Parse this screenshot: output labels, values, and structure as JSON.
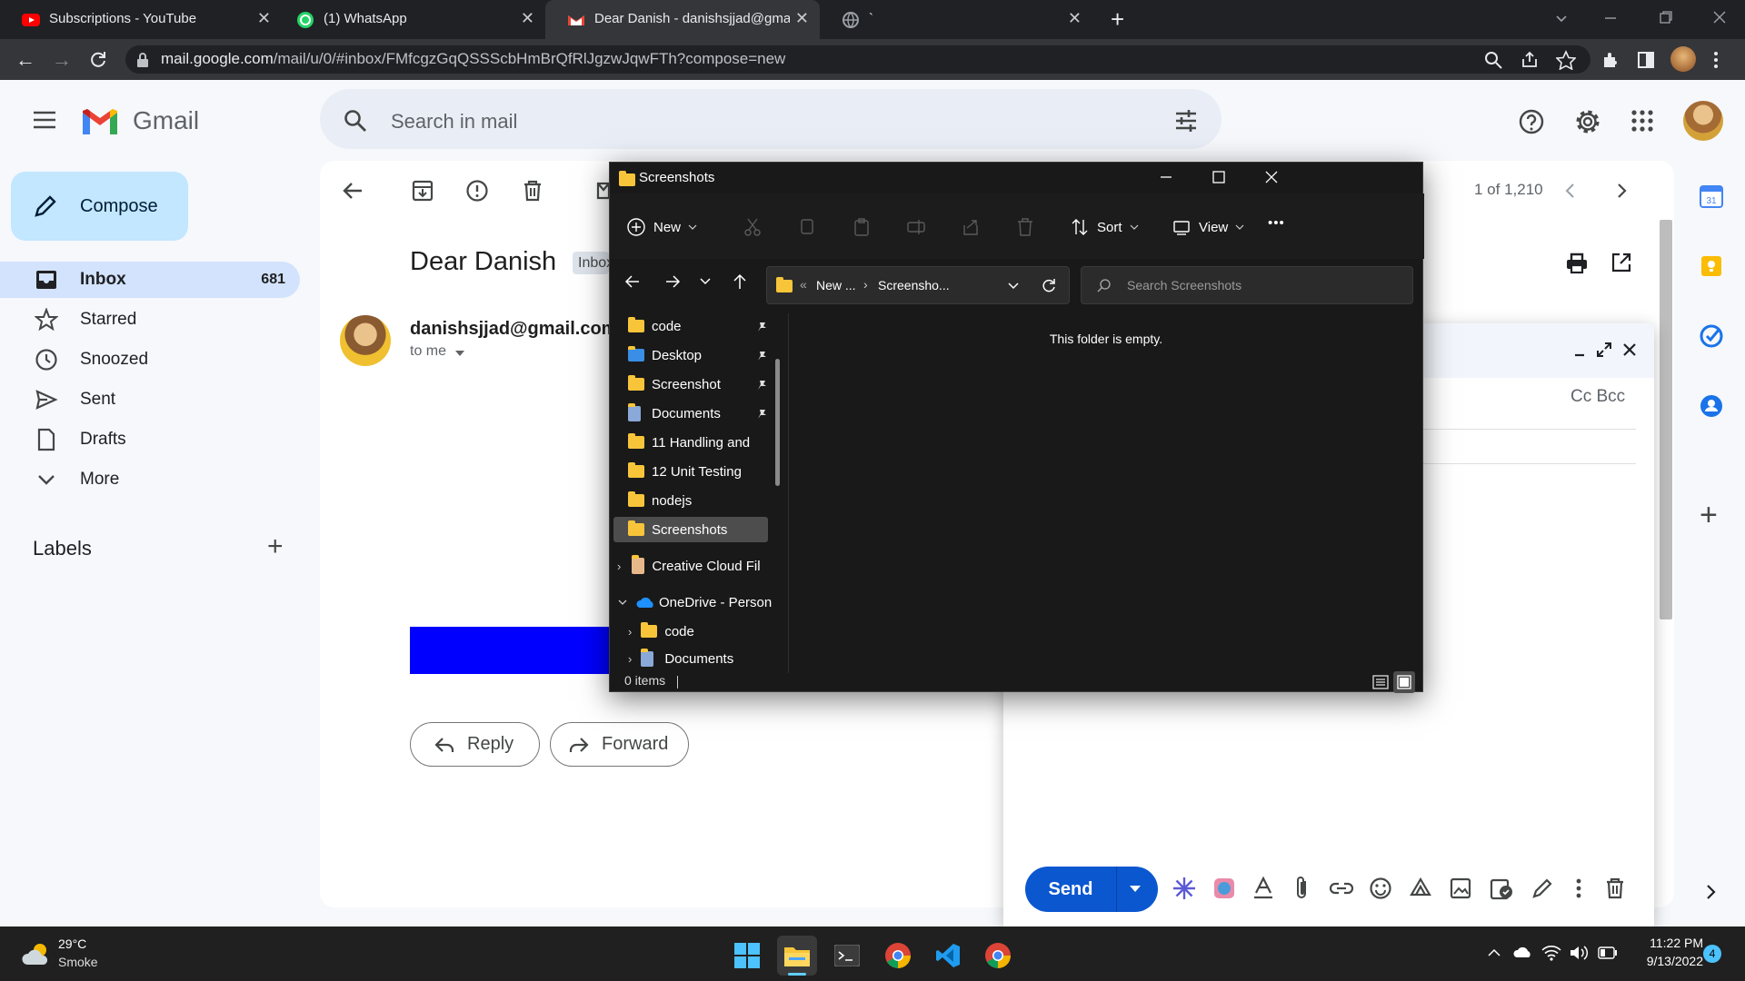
{
  "browser": {
    "tabs": [
      {
        "title": "Subscriptions - YouTube",
        "close": "✕"
      },
      {
        "title": "(1) WhatsApp",
        "close": "✕"
      },
      {
        "title": "Dear Danish - danishsjjad@gmail",
        "close": "✕"
      },
      {
        "title": "`",
        "close": "✕"
      }
    ],
    "new_tab": "+",
    "url_host": "mail.google.com",
    "url_path": "/mail/u/0/#inbox/FMfcgzGqQSSScbHmBrQfRlJgzwJqwFTh?compose=new"
  },
  "gmail": {
    "logo_text": "Gmail",
    "search_placeholder": "Search in mail",
    "compose_label": "Compose",
    "nav": [
      {
        "label": "Inbox",
        "count": "681"
      },
      {
        "label": "Starred"
      },
      {
        "label": "Snoozed"
      },
      {
        "label": "Sent"
      },
      {
        "label": "Drafts"
      },
      {
        "label": "More"
      }
    ],
    "labels_heading": "Labels",
    "labels_add": "+",
    "pager": "1 of 1,210",
    "subject": "Dear Danish",
    "inbox_chip": "Inbox",
    "sender": "danishsjjad@gmail.com",
    "to_me": "to me",
    "reply_label": "Reply",
    "forward_label": "Forward",
    "cc_bcc": "Cc Bcc",
    "send_label": "Send",
    "side_add": "+"
  },
  "explorer": {
    "title": "Screenshots",
    "new_label": "New",
    "sort_label": "Sort",
    "view_label": "View",
    "more": "•••",
    "breadcrumb": [
      "New ...",
      "Screensho..."
    ],
    "search_placeholder": "Search Screenshots",
    "empty_message": "This folder is empty.",
    "status": "0 items",
    "tree": [
      {
        "label": "code",
        "pinned": true
      },
      {
        "label": "Desktop",
        "pinned": true
      },
      {
        "label": "Screenshot",
        "pinned": true
      },
      {
        "label": "Documents",
        "pinned": true
      },
      {
        "label": "11 Handling and"
      },
      {
        "label": "12 Unit Testing"
      },
      {
        "label": "nodejs"
      },
      {
        "label": "Screenshots"
      },
      {
        "label": "Creative Cloud Fil"
      },
      {
        "label": "OneDrive - Person"
      },
      {
        "label": "code"
      },
      {
        "label": "Documents"
      }
    ]
  },
  "taskbar": {
    "weather_temp": "29°C",
    "weather_desc": "Smoke",
    "time": "11:22 PM",
    "date": "9/13/2022",
    "notif_count": "4"
  }
}
